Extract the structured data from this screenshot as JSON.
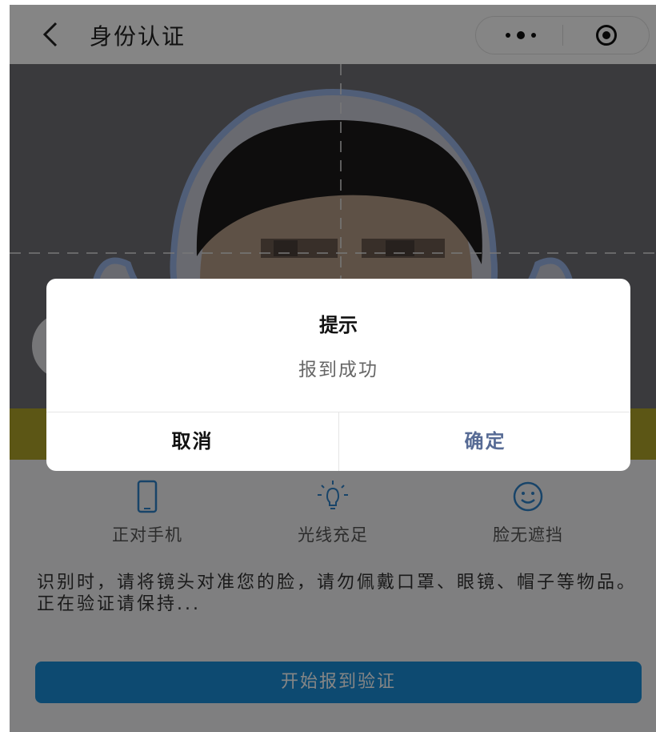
{
  "navbar": {
    "title": "身份认证",
    "back_icon": "chevron-left-icon",
    "more_icon": "more-dots-icon",
    "close_icon": "target-circle-icon"
  },
  "tips": [
    {
      "icon": "phone-icon",
      "label": "正对手机"
    },
    {
      "icon": "light-bulb-icon",
      "label": "光线充足"
    },
    {
      "icon": "smile-icon",
      "label": "脸无遮挡"
    }
  ],
  "instructions": {
    "line1": "识别时，请将镜头对准您的脸，请勿佩戴口罩、眼镜、帽子等物品。",
    "line2": "正在验证请保持..."
  },
  "start_button": "开始报到验证",
  "dialog": {
    "title": "提示",
    "message": "报到成功",
    "cancel_label": "取消",
    "confirm_label": "确定"
  },
  "colors": {
    "accent": "#1a8fd8",
    "confirm_text": "#576b95",
    "face_outline": "#9ab4e6"
  }
}
